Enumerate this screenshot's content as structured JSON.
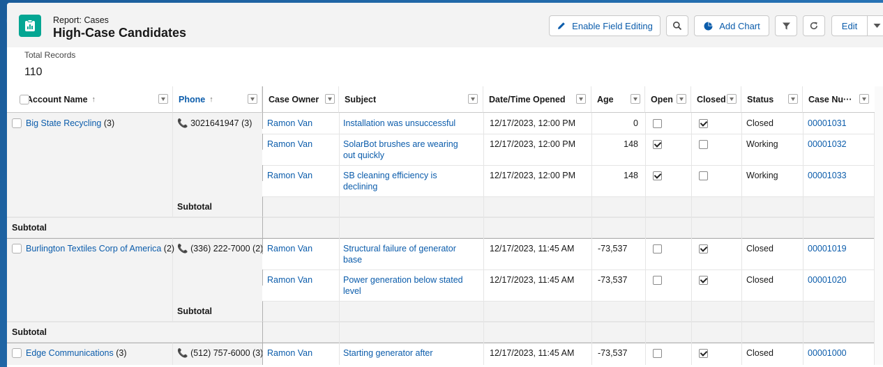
{
  "header": {
    "subtitle": "Report: Cases",
    "title": "High-Case Candidates",
    "buttons": {
      "enable_field_editing": "Enable Field Editing",
      "add_chart": "Add Chart",
      "edit": "Edit"
    }
  },
  "summary": {
    "label": "Total Records",
    "value": "110"
  },
  "columns": {
    "account_name": "Account Name",
    "phone": "Phone",
    "case_owner": "Case Owner",
    "subject": "Subject",
    "opened": "Date/Time Opened",
    "age": "Age",
    "open": "Open",
    "closed": "Closed",
    "status": "Status",
    "case_number": "Case Nu···"
  },
  "subtotal_label": "Subtotal",
  "groups": [
    {
      "account": "Big State Recycling",
      "account_count": "(3)",
      "phone": "3021641947",
      "phone_count": "(3)",
      "rows": [
        {
          "owner": "Ramon Van",
          "subject1": "Installation was unsuccessful",
          "subject2": "",
          "opened": "12/17/2023, 12:00 PM",
          "age": "0",
          "open": false,
          "closed": true,
          "status": "Closed",
          "case_number": "00001031"
        },
        {
          "owner": "Ramon Van",
          "subject1": "SolarBot brushes are wearing",
          "subject2": "out quickly",
          "opened": "12/17/2023, 12:00 PM",
          "age": "148",
          "open": true,
          "closed": false,
          "status": "Working",
          "case_number": "00001032"
        },
        {
          "owner": "Ramon Van",
          "subject1": "SB cleaning efficiency is",
          "subject2": "declining",
          "opened": "12/17/2023, 12:00 PM",
          "age": "148",
          "open": true,
          "closed": false,
          "status": "Working",
          "case_number": "00001033"
        }
      ]
    },
    {
      "account": "Burlington Textiles Corp of America",
      "account_count": "(2)",
      "phone": "(336) 222-7000",
      "phone_count": "(2)",
      "rows": [
        {
          "owner": "Ramon Van",
          "subject1": "Structural failure of generator",
          "subject2": "base",
          "opened": "12/17/2023, 11:45 AM",
          "age": "-73,537",
          "open": false,
          "closed": true,
          "status": "Closed",
          "case_number": "00001019"
        },
        {
          "owner": "Ramon Van",
          "subject1": "Power generation below stated",
          "subject2": "level",
          "opened": "12/17/2023, 11:45 AM",
          "age": "-73,537",
          "open": false,
          "closed": true,
          "status": "Closed",
          "case_number": "00001020"
        }
      ]
    },
    {
      "account": "Edge Communications",
      "account_count": "(3)",
      "phone": "(512) 757-6000",
      "phone_count": "(3)",
      "rows": [
        {
          "owner": "Ramon Van",
          "subject1": "Starting generator after",
          "subject2": "",
          "opened": "12/17/2023, 11:45 AM",
          "age": "-73,537",
          "open": false,
          "closed": true,
          "status": "Closed",
          "case_number": "00001000"
        }
      ]
    }
  ]
}
